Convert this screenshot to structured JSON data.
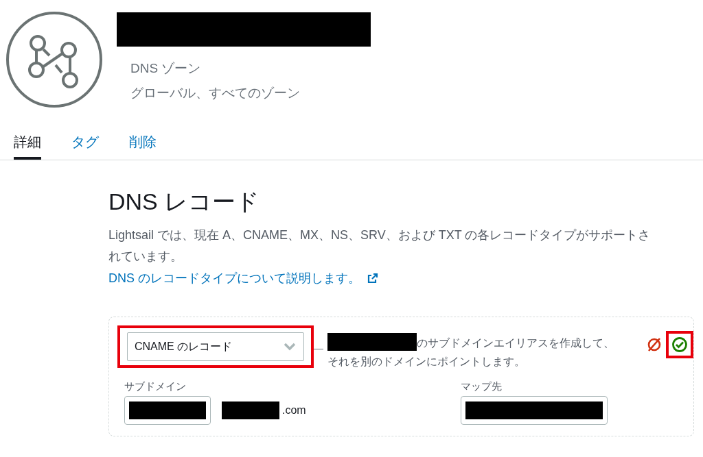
{
  "header": {
    "title_redacted": true,
    "type": "DNS ゾーン",
    "scope": "グローバル、すべてのゾーン"
  },
  "tabs": [
    {
      "label": "詳細",
      "selected": true
    },
    {
      "label": "タグ",
      "selected": false
    },
    {
      "label": "削除",
      "selected": false
    }
  ],
  "section": {
    "title": "DNS レコード",
    "description": "Lightsail では、現在 A、CNAME、MX、NS、SRV、および TXT の各レコードタイプがサポートされています。",
    "link": "DNS のレコードタイプについて説明します。"
  },
  "record": {
    "type": "CNAME のレコード",
    "description": "のサブドメインエイリアスを作成して、それを別のドメインにポイントします。",
    "subdomain_label": "サブドメイン",
    "domain_suffix": ".com",
    "target_label": "マップ先",
    "highlighted": true
  }
}
